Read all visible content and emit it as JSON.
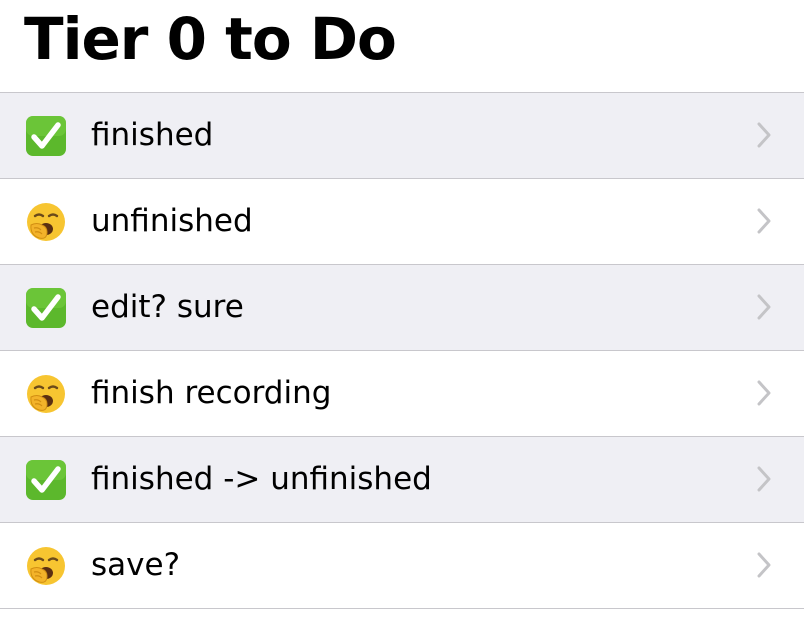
{
  "header": {
    "title": "Tier 0 to Do"
  },
  "colors": {
    "shaded_row": "#efeff4",
    "separator": "#c8c7cc",
    "check_green": "#5cb82c",
    "emoji_yellow": "#f7c531",
    "chevron": "#c4c4c7"
  },
  "items": [
    {
      "label": "finished",
      "status_icon": "check-mark-button-icon",
      "done": true
    },
    {
      "label": "unfinished",
      "status_icon": "yawning-face-icon",
      "done": false
    },
    {
      "label": "edit? sure",
      "status_icon": "check-mark-button-icon",
      "done": true
    },
    {
      "label": "finish recording",
      "status_icon": "yawning-face-icon",
      "done": false
    },
    {
      "label": "finished -> unfinished",
      "status_icon": "check-mark-button-icon",
      "done": true
    },
    {
      "label": "save?",
      "status_icon": "yawning-face-icon",
      "done": false
    }
  ]
}
